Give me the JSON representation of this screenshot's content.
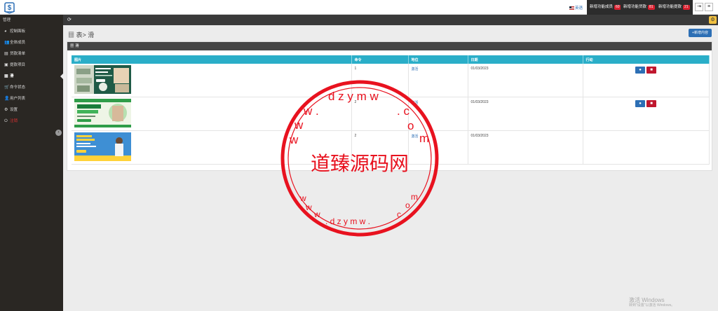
{
  "header": {
    "language": "英语",
    "buttons": [
      {
        "label": "新增功能成员",
        "count": "60"
      },
      {
        "label": "新增功能贷款",
        "count": "81"
      },
      {
        "label": "新增功能提款",
        "count": "21"
      }
    ]
  },
  "sidebar": {
    "heading": "管理",
    "items": [
      {
        "icon": "dashboard-icon",
        "glyph": "◕",
        "label": "控制面板"
      },
      {
        "icon": "users-icon",
        "glyph": "👥",
        "label": "全体成员"
      },
      {
        "icon": "loan-list-icon",
        "glyph": "▤",
        "label": "贷款清单"
      },
      {
        "icon": "withdraw-icon",
        "glyph": "▣",
        "label": "提款项目"
      },
      {
        "icon": "slider-icon",
        "glyph": "▦",
        "label": "滑"
      },
      {
        "icon": "cart-icon",
        "glyph": "🛒",
        "label": "命令状态"
      },
      {
        "icon": "user-list-icon",
        "glyph": "👤",
        "label": "用户列表"
      },
      {
        "icon": "settings-icon",
        "glyph": "⚙",
        "label": "设置"
      },
      {
        "icon": "logout-icon",
        "glyph": "⏻",
        "label": "注销"
      }
    ]
  },
  "page": {
    "title": "表> 滑",
    "add_button": "+新增内容",
    "panel_title": "滑"
  },
  "table": {
    "columns": [
      "图片",
      "命令",
      "地位",
      "日期",
      "行动"
    ],
    "rows": [
      {
        "order": "1",
        "status": "激活",
        "date": "01/03/2023",
        "image_name": "loan-banner-1"
      },
      {
        "order": "2",
        "status": "激活",
        "date": "01/03/2023",
        "image_name": "ofw-loan-banner"
      },
      {
        "order": "2",
        "status": "激活",
        "date": "01/03/2023",
        "image_name": "loan-amount-banner"
      }
    ]
  },
  "watermark": {
    "text": "道臻源码网",
    "ring_text": "www.dzymw.com"
  },
  "os_notice": {
    "title": "激活 Windows",
    "subtitle": "转到\"设置\"以激活 Windows。"
  }
}
